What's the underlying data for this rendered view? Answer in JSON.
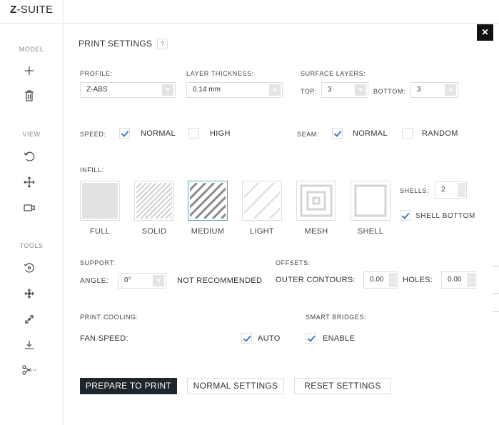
{
  "app": {
    "logo_z": "Z",
    "logo_rest": "-SUITE"
  },
  "sidebar": {
    "model_label": "MODEL",
    "view_label": "VIEW",
    "tools_label": "TOOLS"
  },
  "panel": {
    "title": "PRINT SETTINGS",
    "help": "?",
    "close": "×"
  },
  "profile": {
    "label": "PROFILE:",
    "value": "Z-ABS"
  },
  "layer": {
    "label": "LAYER THICKNESS:",
    "value": "0.14 mm"
  },
  "surface": {
    "label": "SURFACE LAYERS:",
    "top_label": "TOP:",
    "top_value": "3",
    "bottom_label": "BOTTOM:",
    "bottom_value": "3"
  },
  "speed": {
    "label": "SPEED:",
    "normal": "NORMAL",
    "high": "HIGH",
    "normal_checked": true,
    "high_checked": false
  },
  "seam": {
    "label": "SEAM:",
    "normal": "NORMAL",
    "random": "RANDOM",
    "normal_checked": true,
    "random_checked": false
  },
  "infill": {
    "label": "INFILL:",
    "options": [
      "FULL",
      "SOLID",
      "MEDIUM",
      "LIGHT",
      "MESH",
      "SHELL"
    ],
    "selected": "MEDIUM",
    "shells_label": "SHELLS:",
    "shells_value": "2",
    "shell_bottom_label": "SHELL BOTTOM",
    "shell_bottom_checked": true
  },
  "support": {
    "label": "SUPPORT:",
    "angle_label": "ANGLE:",
    "angle_value": "0°",
    "note": "NOT RECOMMENDED"
  },
  "offsets": {
    "label": "OFFSETS:",
    "outer_label": "OUTER CONTOURS:",
    "outer_value": "0.00",
    "holes_label": "HOLES:",
    "holes_value": "0.00"
  },
  "cooling": {
    "label": "PRINT COOLING:",
    "fan_label": "FAN SPEED:",
    "auto_label": "AUTO",
    "auto_checked": true
  },
  "bridges": {
    "label": "SMART BRIDGES:",
    "enable_label": "ENABLE",
    "enable_checked": true
  },
  "actions": {
    "prepare": "PREPARE TO PRINT",
    "normal": "NORMAL SETTINGS",
    "reset": "RESET SETTINGS"
  },
  "colors": {
    "primary_button": "#1e252b",
    "check": "#3a7fc1",
    "selected_border": "#5aa5b5"
  }
}
